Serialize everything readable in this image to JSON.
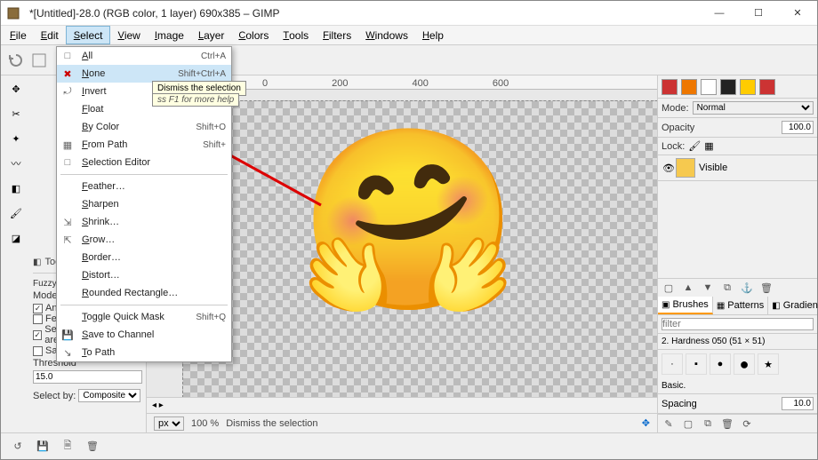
{
  "title": "*[Untitled]-28.0 (RGB color, 1 layer) 690x385 – GIMP",
  "menus": [
    "File",
    "Edit",
    "Select",
    "View",
    "Image",
    "Layer",
    "Colors",
    "Tools",
    "Filters",
    "Windows",
    "Help"
  ],
  "active_menu_index": 2,
  "select_menu": {
    "groups": [
      [
        {
          "icon": "□",
          "label": "All",
          "accel": "Ctrl+A"
        },
        {
          "icon": "✖",
          "label": "None",
          "accel": "Shift+Ctrl+A",
          "hover": true,
          "iconColor": "#c00"
        },
        {
          "icon": "⤾",
          "label": "Invert",
          "accel": ""
        },
        {
          "icon": "",
          "label": "Float",
          "accel": ""
        },
        {
          "icon": "",
          "label": "By Color",
          "accel": "Shift+O"
        },
        {
          "icon": "▦",
          "label": "From Path",
          "accel": "Shift+"
        },
        {
          "icon": "□",
          "label": "Selection Editor",
          "accel": ""
        }
      ],
      [
        {
          "icon": "",
          "label": "Feather…",
          "accel": ""
        },
        {
          "icon": "",
          "label": "Sharpen",
          "accel": ""
        },
        {
          "icon": "⇲",
          "label": "Shrink…",
          "accel": ""
        },
        {
          "icon": "⇱",
          "label": "Grow…",
          "accel": ""
        },
        {
          "icon": "",
          "label": "Border…",
          "accel": ""
        },
        {
          "icon": "",
          "label": "Distort…",
          "accel": ""
        },
        {
          "icon": "",
          "label": "Rounded Rectangle…",
          "accel": ""
        }
      ],
      [
        {
          "icon": "",
          "label": "Toggle Quick Mask",
          "accel": "Shift+Q"
        },
        {
          "icon": "💾",
          "label": "Save to Channel",
          "accel": ""
        },
        {
          "icon": "↘",
          "label": "To Path",
          "accel": ""
        }
      ]
    ]
  },
  "tooltip_text": "Dismiss the selection",
  "help_hint": "ss F1 for more help",
  "ruler_ticks": [
    "0",
    "200",
    "400",
    "600"
  ],
  "status": {
    "unit": "px",
    "zoom": "100 %",
    "msg": "Dismiss the selection"
  },
  "tool_options": {
    "header": "Tool Options",
    "tool_name": "Fuzzy Select",
    "mode_label": "Mode:",
    "checks": [
      {
        "checked": true,
        "label": "Antialiasing"
      },
      {
        "checked": false,
        "label": "Feather edges"
      },
      {
        "checked": true,
        "label": "Select transparent areas"
      },
      {
        "checked": false,
        "label": "Sample merged"
      }
    ],
    "threshold_label": "Threshold",
    "threshold_value": "15.0",
    "selectby_label": "Select by:",
    "selectby_value": "Composite"
  },
  "right": {
    "mode_label": "Mode:",
    "mode_value": "Normal",
    "opacity_label": "Opacity",
    "opacity_value": "100.0",
    "lock_label": "Lock:",
    "layer_name": "Visible",
    "brush_tab": "Brushes",
    "pattern_tab": "Patterns",
    "gradient_tab": "Gradients",
    "filter_placeholder": "filter",
    "brush_info": "2. Hardness 050 (51 × 51)",
    "basic_label": "Basic.",
    "spacing_label": "Spacing",
    "spacing_value": "10.0"
  }
}
